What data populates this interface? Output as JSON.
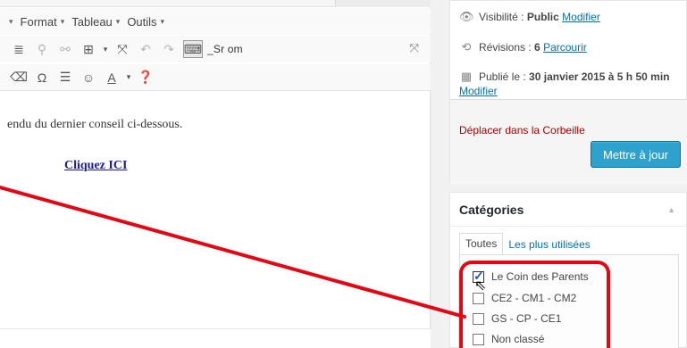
{
  "editor": {
    "menus": [
      "Format",
      "Tableau",
      "Outils"
    ],
    "toolbar_text": "_Sr om",
    "content_text": "endu du dernier conseil ci-dessous.",
    "link_text": "Cliquez ICI"
  },
  "publish": {
    "visibility_label": "Visibilité : ",
    "visibility_value": "Public",
    "visibility_link": "Modifier",
    "revisions_label": "Révisions : ",
    "revisions_value": "6",
    "revisions_link": "Parcourir",
    "published_label": "Publié le : ",
    "published_value": "30 janvier 2015 à 5 h 50 min",
    "published_link": "Modifier",
    "trash_link": "Déplacer dans la Corbeille",
    "update_button": "Mettre à jour"
  },
  "categories": {
    "title": "Catégories",
    "tabs": [
      "Toutes",
      "Les plus utilisées"
    ],
    "items": [
      {
        "label": "Le Coin des Parents",
        "checked": true
      },
      {
        "label": "CE2 - CM1 - CM2",
        "checked": false
      },
      {
        "label": "GS - CP - CE1",
        "checked": false
      },
      {
        "label": "Non classé",
        "checked": false
      }
    ]
  },
  "icons": {
    "visibility": "eye-icon",
    "revisions": "history-icon",
    "published": "calendar-icon"
  },
  "colors": {
    "accent": "#0073aa",
    "button": "#2ea2cc",
    "annotation": "#e30613",
    "trash": "#a00000"
  }
}
